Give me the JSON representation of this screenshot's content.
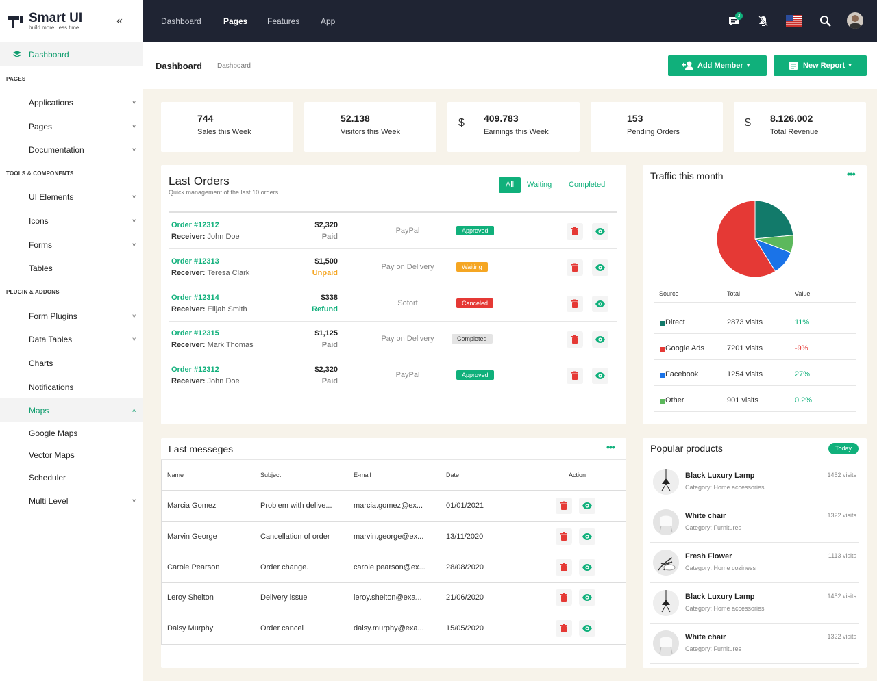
{
  "brand": {
    "name": "Smart UI",
    "tagline": "build more, less time"
  },
  "sidebar": {
    "dashboard": "Dashboard",
    "sections": [
      "PAGES",
      "TOOLS & COMPONENTS",
      "PLUGIN & ADDONS"
    ],
    "items": [
      {
        "label": "Applications",
        "icon": "apps-icon"
      },
      {
        "label": "Pages",
        "icon": "page-icon"
      },
      {
        "label": "Documentation",
        "icon": "doc-icon"
      },
      {
        "label": "UI Elements",
        "icon": "grid-icon"
      },
      {
        "label": "Icons",
        "icon": "heart-icon"
      },
      {
        "label": "Forms",
        "icon": "form-icon"
      },
      {
        "label": "Tables",
        "icon": "table-icon"
      },
      {
        "label": "Form Plugins",
        "icon": "form-plugin-icon"
      },
      {
        "label": "Data Tables",
        "icon": "datatable-icon"
      },
      {
        "label": "Charts",
        "icon": "pie-icon"
      },
      {
        "label": "Notifications",
        "icon": "bell-icon"
      },
      {
        "label": "Maps",
        "icon": "map-pin-icon"
      },
      {
        "label": "Scheduler",
        "icon": "calendar-icon"
      },
      {
        "label": "Multi Level",
        "icon": "share-icon"
      }
    ],
    "maps_sub": [
      "Google Maps",
      "Vector Maps"
    ]
  },
  "topbar": {
    "nav": [
      "Dashboard",
      "Pages",
      "Features",
      "App"
    ],
    "message_count": "3"
  },
  "header": {
    "title": "Dashboard",
    "breadcrumb": "Dashboard",
    "add_member": "Add Member",
    "new_report": "New Report"
  },
  "stats": [
    {
      "value": "744",
      "label": "Sales this Week",
      "color": "#10b07b"
    },
    {
      "value": "52.138",
      "label": "Visitors this Week",
      "color": "#f5a623"
    },
    {
      "value": "409.783",
      "label": "Earnings this Week",
      "color": "#10b07b"
    },
    {
      "value": "153",
      "label": "Pending Orders",
      "color": "#8e5ce6"
    },
    {
      "value": "8.126.002",
      "label": "Total Revenue",
      "color": "#e53935"
    }
  ],
  "orders": {
    "title": "Last Orders",
    "subtitle": "Quick management of the last 10 orders",
    "filters": [
      "All",
      "Waiting",
      "Completed"
    ],
    "receiver_label": "Receiver:",
    "rows": [
      {
        "id": "Order #12312",
        "receiver": "John Doe",
        "amount": "$2,320",
        "pay_status": "Paid",
        "method": "PayPal",
        "status": "Approved"
      },
      {
        "id": "Order #12313",
        "receiver": "Teresa Clark",
        "amount": "$1,500",
        "pay_status": "Unpaid",
        "method": "Pay on Delivery",
        "status": "Waiting"
      },
      {
        "id": "Order #12314",
        "receiver": "Elijah Smith",
        "amount": "$338",
        "pay_status": "Refund",
        "method": "Sofort",
        "status": "Canceled"
      },
      {
        "id": "Order #12315",
        "receiver": "Mark Thomas",
        "amount": "$1,125",
        "pay_status": "Paid",
        "method": "Pay on Delivery",
        "status": "Completed"
      },
      {
        "id": "Order #12312",
        "receiver": "John Doe",
        "amount": "$2,320",
        "pay_status": "Paid",
        "method": "PayPal",
        "status": "Approved"
      }
    ]
  },
  "traffic": {
    "title": "Traffic this month",
    "headers": [
      "Source",
      "Total",
      "Value"
    ],
    "rows": [
      {
        "source": "Direct",
        "total": "2873 visits",
        "value": "11%",
        "color": "#127a6a"
      },
      {
        "source": "Google Ads",
        "total": "7201 visits",
        "value": "-9%",
        "color": "#e53935"
      },
      {
        "source": "Facebook",
        "total": "1254 visits",
        "value": "27%",
        "color": "#1a73e8"
      },
      {
        "source": "Other",
        "total": "901 visits",
        "value": "0.2%",
        "color": "#5cb85c"
      }
    ]
  },
  "chart_data": {
    "type": "pie",
    "categories": [
      "Direct",
      "Google Ads",
      "Facebook",
      "Other"
    ],
    "values": [
      2873,
      7201,
      1254,
      901
    ],
    "colors": [
      "#127a6a",
      "#e53935",
      "#1a73e8",
      "#5cb85c"
    ]
  },
  "messages": {
    "title": "Last messeges",
    "headers": [
      "Name",
      "Subject",
      "E-mail",
      "Date",
      "Action"
    ],
    "rows": [
      {
        "name": "Marcia Gomez",
        "subject": "Problem with delive...",
        "email": "marcia.gomez@ex...",
        "date": "01/01/2021"
      },
      {
        "name": "Marvin George",
        "subject": "Cancellation of order",
        "email": "marvin.george@ex...",
        "date": "13/11/2020"
      },
      {
        "name": "Carole Pearson",
        "subject": "Order change.",
        "email": "carole.pearson@ex...",
        "date": "28/08/2020"
      },
      {
        "name": "Leroy Shelton",
        "subject": "Delivery issue",
        "email": "leroy.shelton@exa...",
        "date": "21/06/2020"
      },
      {
        "name": "Daisy Murphy",
        "subject": "Order cancel",
        "email": "daisy.murphy@exa...",
        "date": "15/05/2020"
      }
    ]
  },
  "products": {
    "title": "Popular products",
    "badge": "Today",
    "rows": [
      {
        "name": "Black Luxury Lamp",
        "category": "Category: Home accessories",
        "visits": "1452 visits"
      },
      {
        "name": "White chair",
        "category": "Category: Furnitures",
        "visits": "1322 visits"
      },
      {
        "name": "Fresh Flower",
        "category": "Category: Home coziness",
        "visits": "1113 visits"
      },
      {
        "name": "Black Luxury Lamp",
        "category": "Category: Home accessories",
        "visits": "1452 visits"
      },
      {
        "name": "White chair",
        "category": "Category: Furnitures",
        "visits": "1322 visits"
      }
    ]
  },
  "colors": {
    "accent": "#10b07b",
    "topbar": "#1f2433",
    "bg": "#f7f3ea",
    "danger": "#e53935",
    "warning": "#f5a623"
  }
}
